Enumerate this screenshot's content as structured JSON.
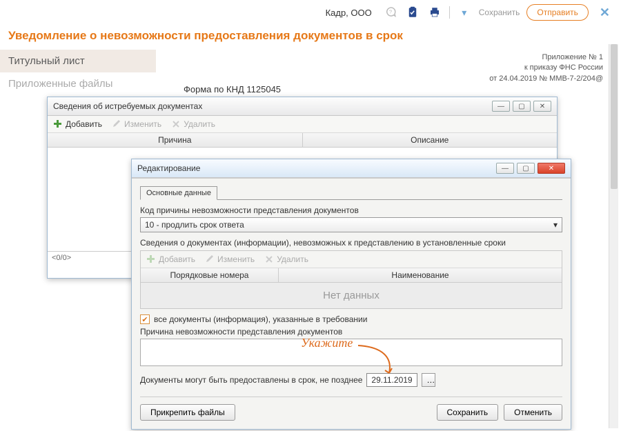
{
  "topbar": {
    "company": "Кадр, ООО",
    "save": "Сохранить",
    "send": "Отправить"
  },
  "doc_title": "Уведомление о невозможности предоставления документов в срок",
  "tabs": {
    "title_page": "Титульный лист",
    "attached": "Приложенные файлы"
  },
  "meta": {
    "line1": "Приложение № 1",
    "line2": "к приказу ФНС России",
    "line3": "от 24.04.2019 № ММВ-7-2/204@"
  },
  "form_code": "Форма по КНД 1125045",
  "win1": {
    "title": "Сведения об истребуемых документах",
    "add": "Добавить",
    "edit": "Изменить",
    "del": "Удалить",
    "col1": "Причина",
    "col2": "Описание",
    "status": "<0/0>"
  },
  "win2": {
    "title": "Редактирование",
    "tab": "Основные данные",
    "code_label": "Код причины невозможности представления документов",
    "code_value": "10 - продлить срок ответа",
    "docs_label": "Сведения о документах (информации), невозможных к представлению в установленные сроки",
    "add": "Добавить",
    "edit": "Изменить",
    "del": "Удалить",
    "col1": "Порядковые номера",
    "col2": "Наименование",
    "nodata": "Нет данных",
    "check_label": "все документы (информация), указанные в требовании",
    "reason_label": "Причина невозможности представления документов",
    "deadline_label": "Документы могут быть предоставлены в срок, не позднее",
    "date": "29.11.2019",
    "attach": "Прикрепить файлы",
    "save": "Сохранить",
    "cancel": "Отменить"
  },
  "annotation": "Укажите"
}
